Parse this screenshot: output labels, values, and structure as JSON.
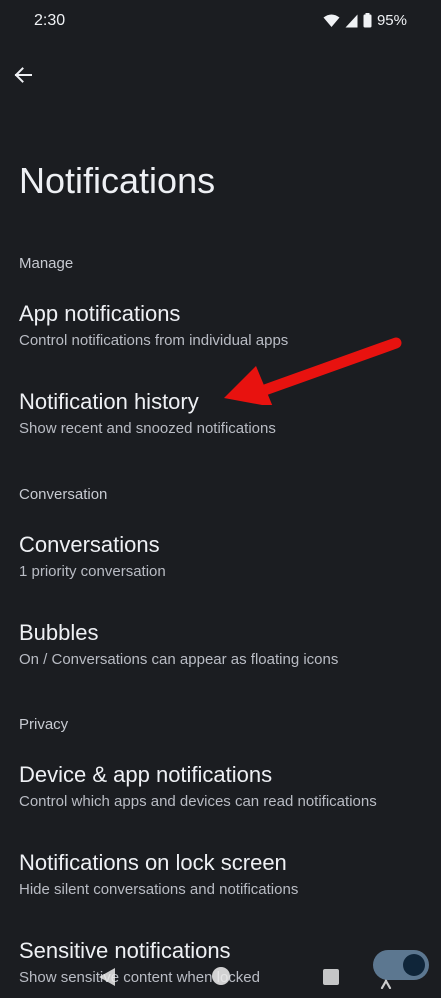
{
  "status_bar": {
    "time": "2:30",
    "battery": "95%",
    "icons": [
      "wifi-icon",
      "signal-icon",
      "battery-icon"
    ]
  },
  "header": {
    "back_icon": "back-arrow-icon",
    "title": "Notifications"
  },
  "sections": {
    "manage": {
      "header": "Manage",
      "items": [
        {
          "title": "App notifications",
          "subtitle": "Control notifications from individual apps"
        },
        {
          "title": "Notification history",
          "subtitle": "Show recent and snoozed notifications"
        }
      ]
    },
    "conversation": {
      "header": "Conversation",
      "items": [
        {
          "title": "Conversations",
          "subtitle": "1 priority conversation"
        },
        {
          "title": "Bubbles",
          "subtitle": "On / Conversations can appear as floating icons"
        }
      ]
    },
    "privacy": {
      "header": "Privacy",
      "items": [
        {
          "title": "Device & app notifications",
          "subtitle": "Control which apps and devices can read notifications"
        },
        {
          "title": "Notifications on lock screen",
          "subtitle": "Hide silent conversations and notifications"
        },
        {
          "title": "Sensitive notifications",
          "subtitle": "Show sensitive content when locked"
        }
      ]
    }
  },
  "annotation": {
    "arrow_color": "#e8120f",
    "points_to": "Notification history"
  },
  "toggle": {
    "state": "on",
    "track_color": "#5c7790",
    "knob_color": "#0f2539"
  },
  "nav_bar": {
    "icons": [
      "nav-back-icon",
      "nav-home-icon",
      "nav-recents-icon",
      "accessibility-icon"
    ]
  }
}
